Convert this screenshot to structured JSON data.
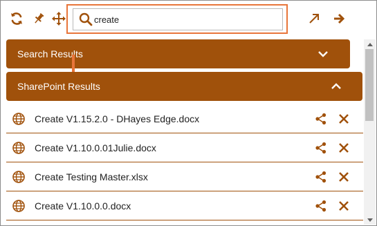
{
  "toolbar": {
    "icons": [
      "refresh-icon",
      "pin-icon",
      "move-icon",
      "expand-icon",
      "forward-icon"
    ]
  },
  "search": {
    "value": "create",
    "icon": "search-icon"
  },
  "sections": {
    "search_results": {
      "label": "Search Results",
      "state": "collapsed"
    },
    "sharepoint_results": {
      "label": "SharePoint Results",
      "state": "expanded"
    }
  },
  "results": [
    {
      "name": "Create V1.15.2.0 - DHayes Edge.docx"
    },
    {
      "name": "Create V1.10.0.01Julie.docx"
    },
    {
      "name": "Create Testing Master.xlsx"
    },
    {
      "name": "Create V1.10.0.0.docx"
    }
  ],
  "colors": {
    "accent": "#a0510b",
    "highlight": "#e8753a",
    "text": "#222222"
  }
}
